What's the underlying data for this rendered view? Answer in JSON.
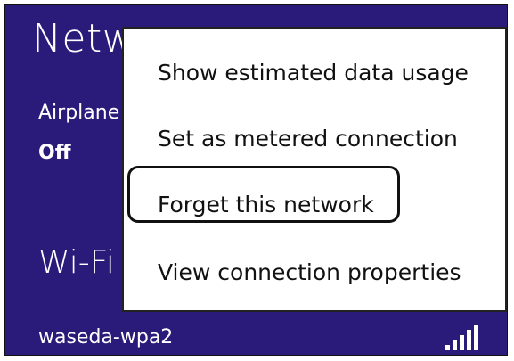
{
  "panel": {
    "title": "Netw",
    "airplane_label": "Airplane",
    "airplane_value": "Off",
    "wifi_title": "Wi-Fi"
  },
  "network": {
    "name": "waseda-wpa2",
    "signal_icon": "wifi-signal-bars-icon"
  },
  "context_menu": {
    "items": [
      {
        "label": "Show estimated data usage"
      },
      {
        "label": "Set as metered connection"
      },
      {
        "label": "Forget this network"
      },
      {
        "label": "View connection properties"
      }
    ],
    "highlighted_index": 2
  },
  "colors": {
    "panel_background": "#2a1a7a",
    "panel_text": "#ffffff",
    "menu_background": "#ffffff",
    "menu_text": "#111111",
    "highlight_border": "#111111"
  }
}
